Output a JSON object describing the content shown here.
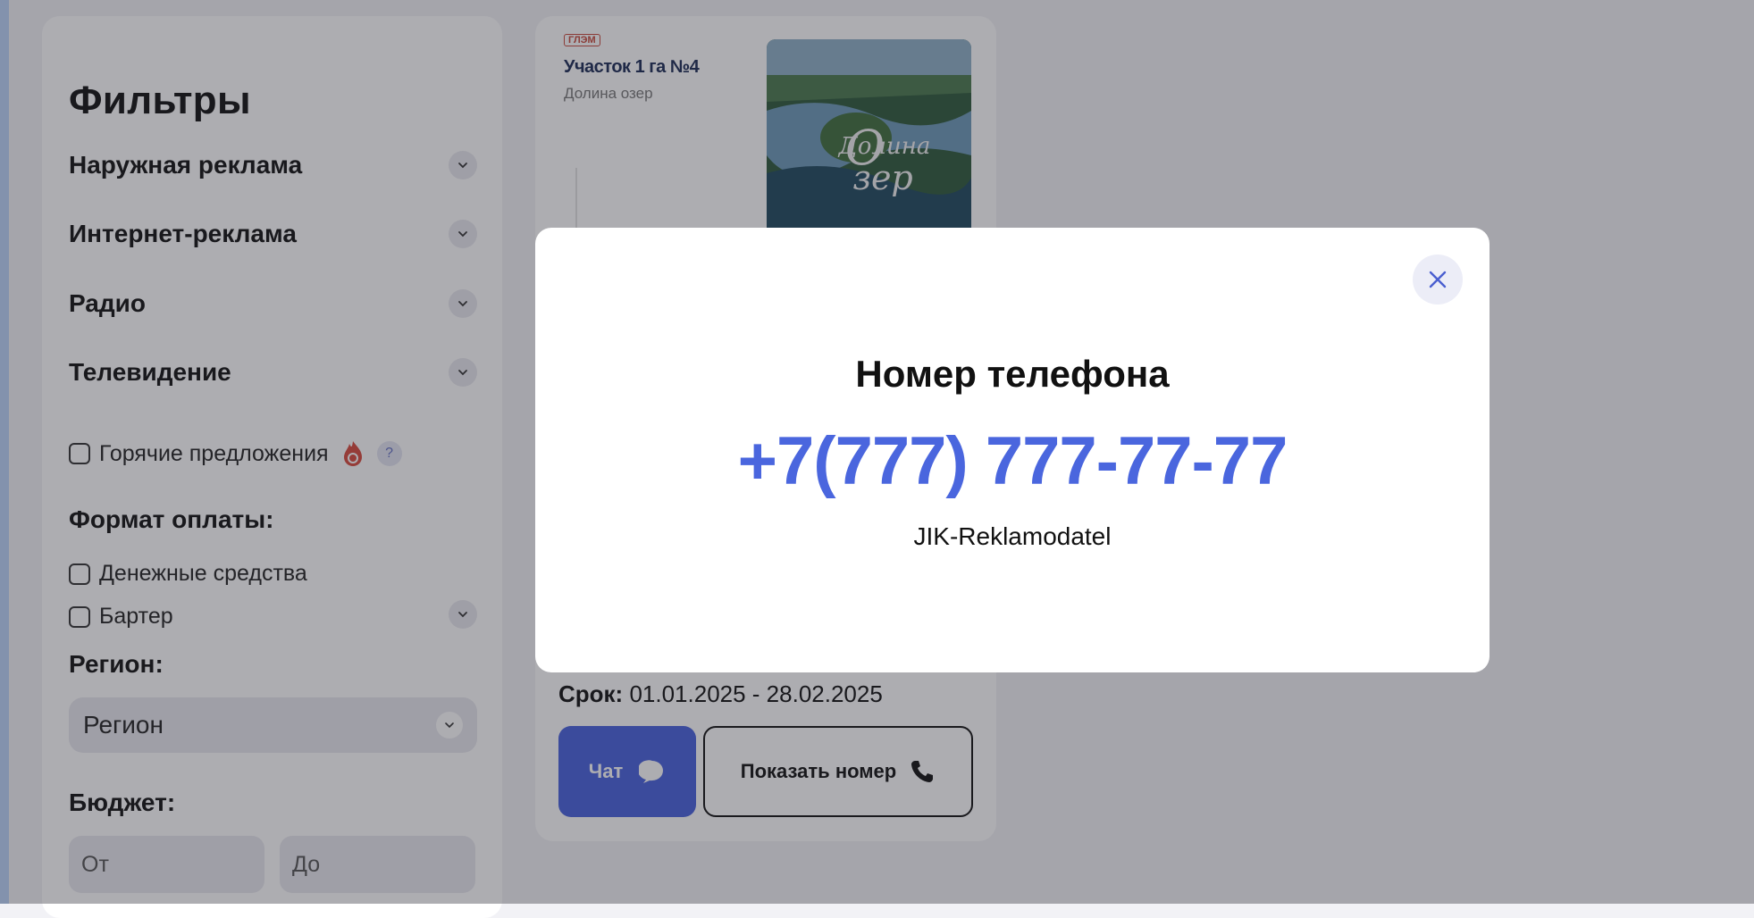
{
  "sidebar": {
    "title": "Фильтры",
    "categories": [
      {
        "label": "Наружная реклама"
      },
      {
        "label": "Интернет-реклама"
      },
      {
        "label": "Радио"
      },
      {
        "label": "Телевидение"
      }
    ],
    "hot_offers_label": "Горячие предложения",
    "help_glyph": "?",
    "payment_title": "Формат оплаты:",
    "payment_options": [
      {
        "label": "Денежные средства",
        "checked": false
      },
      {
        "label": "Бартер",
        "checked": false
      }
    ],
    "region_title": "Регион:",
    "region_select_value": "Регион",
    "budget_title": "Бюджет:",
    "budget_from_placeholder": "От",
    "budget_to_placeholder": "До"
  },
  "card": {
    "thumb_badge": "ГЛЭМ",
    "thumb_title": "Участок 1 га №4",
    "thumb_subtitle": "Долина озер",
    "term_label": "Срок:",
    "term_value": "01.01.2025 - 28.02.2025",
    "chat_label": "Чат",
    "show_number_label": "Показать номер"
  },
  "modal": {
    "title": "Номер телефона",
    "phone": "+7(777) 777-77-77",
    "name": "JIK-Reklamodatel"
  },
  "colors": {
    "accent": "#4761de",
    "phone_text": "#4a66de",
    "hot_icon": "#d94a3c"
  },
  "icons": [
    "chevron-down-icon",
    "fire-icon",
    "help-icon",
    "chat-bubble-icon",
    "phone-icon",
    "close-icon"
  ]
}
